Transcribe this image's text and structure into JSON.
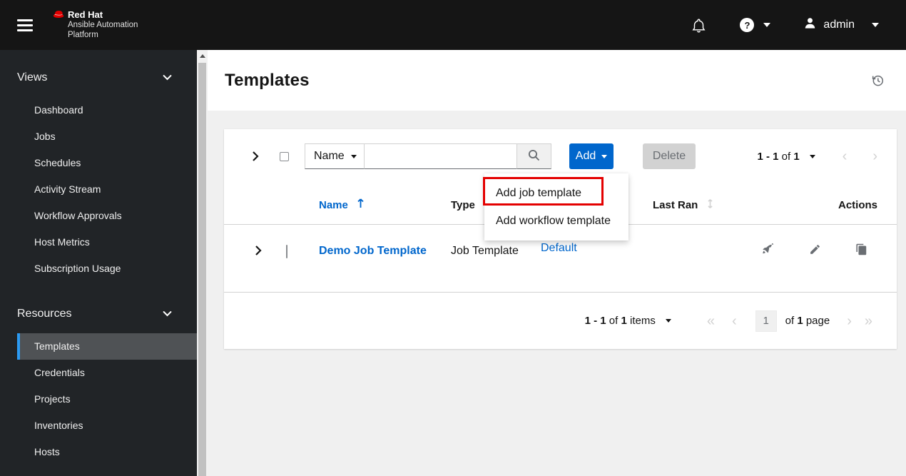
{
  "colors": {
    "accent_blue": "#0066cc",
    "annotation_red": "#e40000",
    "masthead_bg": "#151515",
    "sidebar_bg": "#212427",
    "selected_item_bg": "#4f5255",
    "selected_indicator_blue": "#2b9af3",
    "page_bg": "#f0f0f0",
    "icon_gray": "#6a6e73",
    "border_gray": "#d2d2d2"
  },
  "icons": {
    "menu": "hamburger-icon",
    "brand": "redhat-fedora-icon",
    "notifications": "bell-icon",
    "help": "question-circle-icon",
    "user": "user-icon",
    "section_toggle": "chevron-down-icon",
    "expand": "angle-right-icon",
    "search": "search-icon",
    "history": "history-icon",
    "sort_ascending": "long-arrow-up-icon",
    "sort_inactive": "arrows-vertical-icon",
    "launch": "rocket-icon",
    "edit": "pencil-icon",
    "copy": "copy-icon"
  },
  "masthead": {
    "brand_title": "Red Hat",
    "brand_line2": "Ansible Automation",
    "brand_line3": "Platform",
    "help_glyph": "?",
    "user_name": "admin"
  },
  "sidebar": {
    "sections": [
      {
        "label": "Views",
        "items": [
          {
            "label": "Dashboard"
          },
          {
            "label": "Jobs"
          },
          {
            "label": "Schedules"
          },
          {
            "label": "Activity Stream"
          },
          {
            "label": "Workflow Approvals"
          },
          {
            "label": "Host Metrics"
          },
          {
            "label": "Subscription Usage"
          }
        ]
      },
      {
        "label": "Resources",
        "items": [
          {
            "label": "Templates",
            "selected": true
          },
          {
            "label": "Credentials"
          },
          {
            "label": "Projects"
          },
          {
            "label": "Inventories"
          },
          {
            "label": "Hosts"
          }
        ]
      }
    ]
  },
  "page": {
    "title": "Templates"
  },
  "toolbar": {
    "filter_selected": "Name",
    "search_value": "",
    "add_label": "Add",
    "delete_label": "Delete",
    "pagination": {
      "range": "1 - 1",
      "of_word": "of",
      "total": "1",
      "prev_glyph": "‹",
      "next_glyph": "›"
    }
  },
  "add_menu": {
    "items": [
      {
        "label": "Add job template",
        "annotated": true
      },
      {
        "label": "Add workflow template",
        "annotated": false
      }
    ]
  },
  "table": {
    "headers": {
      "name": "Name",
      "type": "Type",
      "last_ran": "Last Ran",
      "actions": "Actions"
    },
    "rows": [
      {
        "name": "Demo Job Template",
        "type": "Job Template",
        "organization": "Default",
        "last_ran": ""
      }
    ]
  },
  "pagination_footer": {
    "range": "1 - 1",
    "of_word": "of",
    "total": "1",
    "items_word": "items",
    "first_glyph": "«",
    "prev_glyph": "‹",
    "page_value": "1",
    "page_of_word": "of",
    "page_total": "1",
    "page_word": "page",
    "next_glyph": "›",
    "last_glyph": "»"
  }
}
